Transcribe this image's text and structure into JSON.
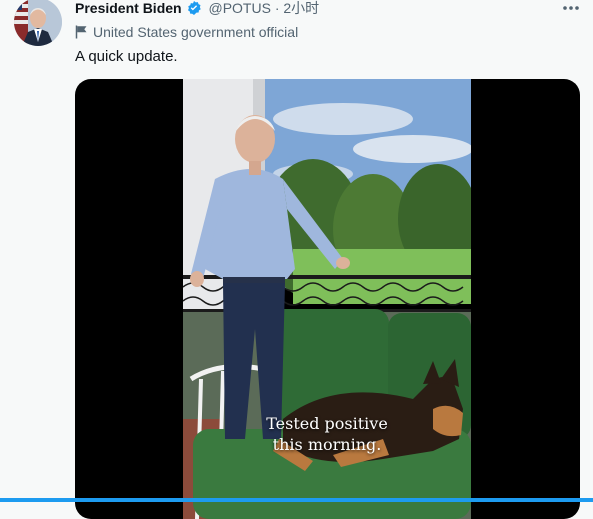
{
  "author": {
    "display_name": "President Biden",
    "handle": "@POTUS",
    "separator": "·",
    "time": "2小时"
  },
  "affiliation": {
    "label": "United States government official",
    "icon": "flag-icon"
  },
  "tweet": {
    "text": "A quick update."
  },
  "video": {
    "caption_line1": "Tested positive",
    "caption_line2": "this morning."
  },
  "colors": {
    "accent": "#1d9bf0",
    "secondary_text": "#536471",
    "primary_text": "#0f1419",
    "background": "#f7f9f9"
  }
}
